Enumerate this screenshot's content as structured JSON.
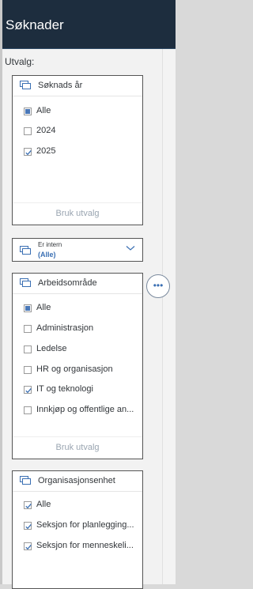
{
  "header": {
    "title": "Søknader"
  },
  "panel": {
    "label": "Utvalg:"
  },
  "cards": {
    "soknadsar": {
      "title": "Søknads år",
      "options": [
        {
          "label": "Alle",
          "state": "partial"
        },
        {
          "label": "2024",
          "state": "unchecked"
        },
        {
          "label": "2025",
          "state": "checked"
        }
      ],
      "footer": "Bruk utvalg"
    },
    "erintern": {
      "label": "Er intern",
      "value": "(Alle)"
    },
    "arbeidsomrade": {
      "title": "Arbeidsområde",
      "options": [
        {
          "label": "Alle",
          "state": "partial"
        },
        {
          "label": "Administrasjon",
          "state": "unchecked"
        },
        {
          "label": "Ledelse",
          "state": "unchecked"
        },
        {
          "label": "HR og organisasjon",
          "state": "unchecked"
        },
        {
          "label": "IT og teknologi",
          "state": "checked"
        },
        {
          "label": "Innkjøp og offentlige an...",
          "state": "unchecked"
        }
      ],
      "footer": "Bruk utvalg"
    },
    "organisasjonsenhet": {
      "title": "Organisasjonsenhet",
      "options": [
        {
          "label": "Alle",
          "state": "checked"
        },
        {
          "label": "Seksjon for planlegging...",
          "state": "checked"
        },
        {
          "label": "Seksjon for menneskeli...",
          "state": "checked"
        }
      ]
    }
  },
  "more_button": {
    "label": "•••"
  },
  "colors": {
    "header_bg": "#1d2d3e",
    "accent": "#4a78b8",
    "link": "#3a6fb3"
  }
}
